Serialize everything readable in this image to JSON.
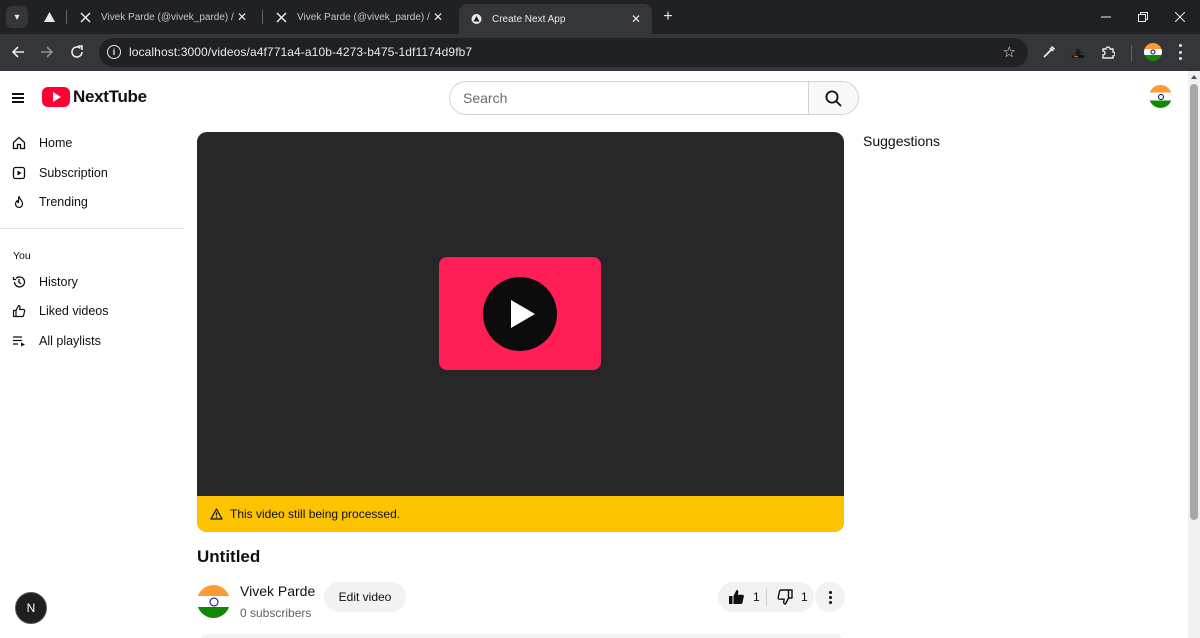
{
  "browser": {
    "tabs": [
      {
        "title": "",
        "icon": "vercel-triangle-icon",
        "close": ""
      },
      {
        "title": "Vivek Parde (@vivek_parde) / X",
        "icon": "x-logo-icon",
        "close": "✕"
      },
      {
        "title": "Vivek Parde (@vivek_parde) / X",
        "icon": "x-logo-icon",
        "close": "✕"
      },
      {
        "title": "Create Next App",
        "icon": "vercel-triangle-icon",
        "close": "✕",
        "active": true
      }
    ],
    "new_tab": "+",
    "url": "localhost:3000/videos/a4f771a4-a10b-4273-b475-1df1174d9fb7"
  },
  "app": {
    "brand": "NextTube",
    "brand_color": "#ff0033",
    "search": {
      "placeholder": "Search",
      "value": ""
    }
  },
  "sidebar": {
    "main": [
      {
        "label": "Home",
        "icon": "home-icon"
      },
      {
        "label": "Subscription",
        "icon": "subscription-icon"
      },
      {
        "label": "Trending",
        "icon": "flame-icon"
      }
    ],
    "you_heading": "You",
    "you": [
      {
        "label": "History",
        "icon": "history-icon"
      },
      {
        "label": "Liked videos",
        "icon": "thumbs-up-icon"
      },
      {
        "label": "All playlists",
        "icon": "playlist-icon"
      }
    ]
  },
  "player": {
    "status": "This video still being processed.",
    "status_color": "#fcc400",
    "thumbnail_color": "#ff1e56"
  },
  "suggestions_heading": "Suggestions",
  "video": {
    "title": "Untitled",
    "channel_name": "Vivek Parde",
    "subscribers": "0 subscribers",
    "edit_label": "Edit video",
    "likes": "1",
    "dislikes": "1"
  },
  "dev_badge": "N"
}
